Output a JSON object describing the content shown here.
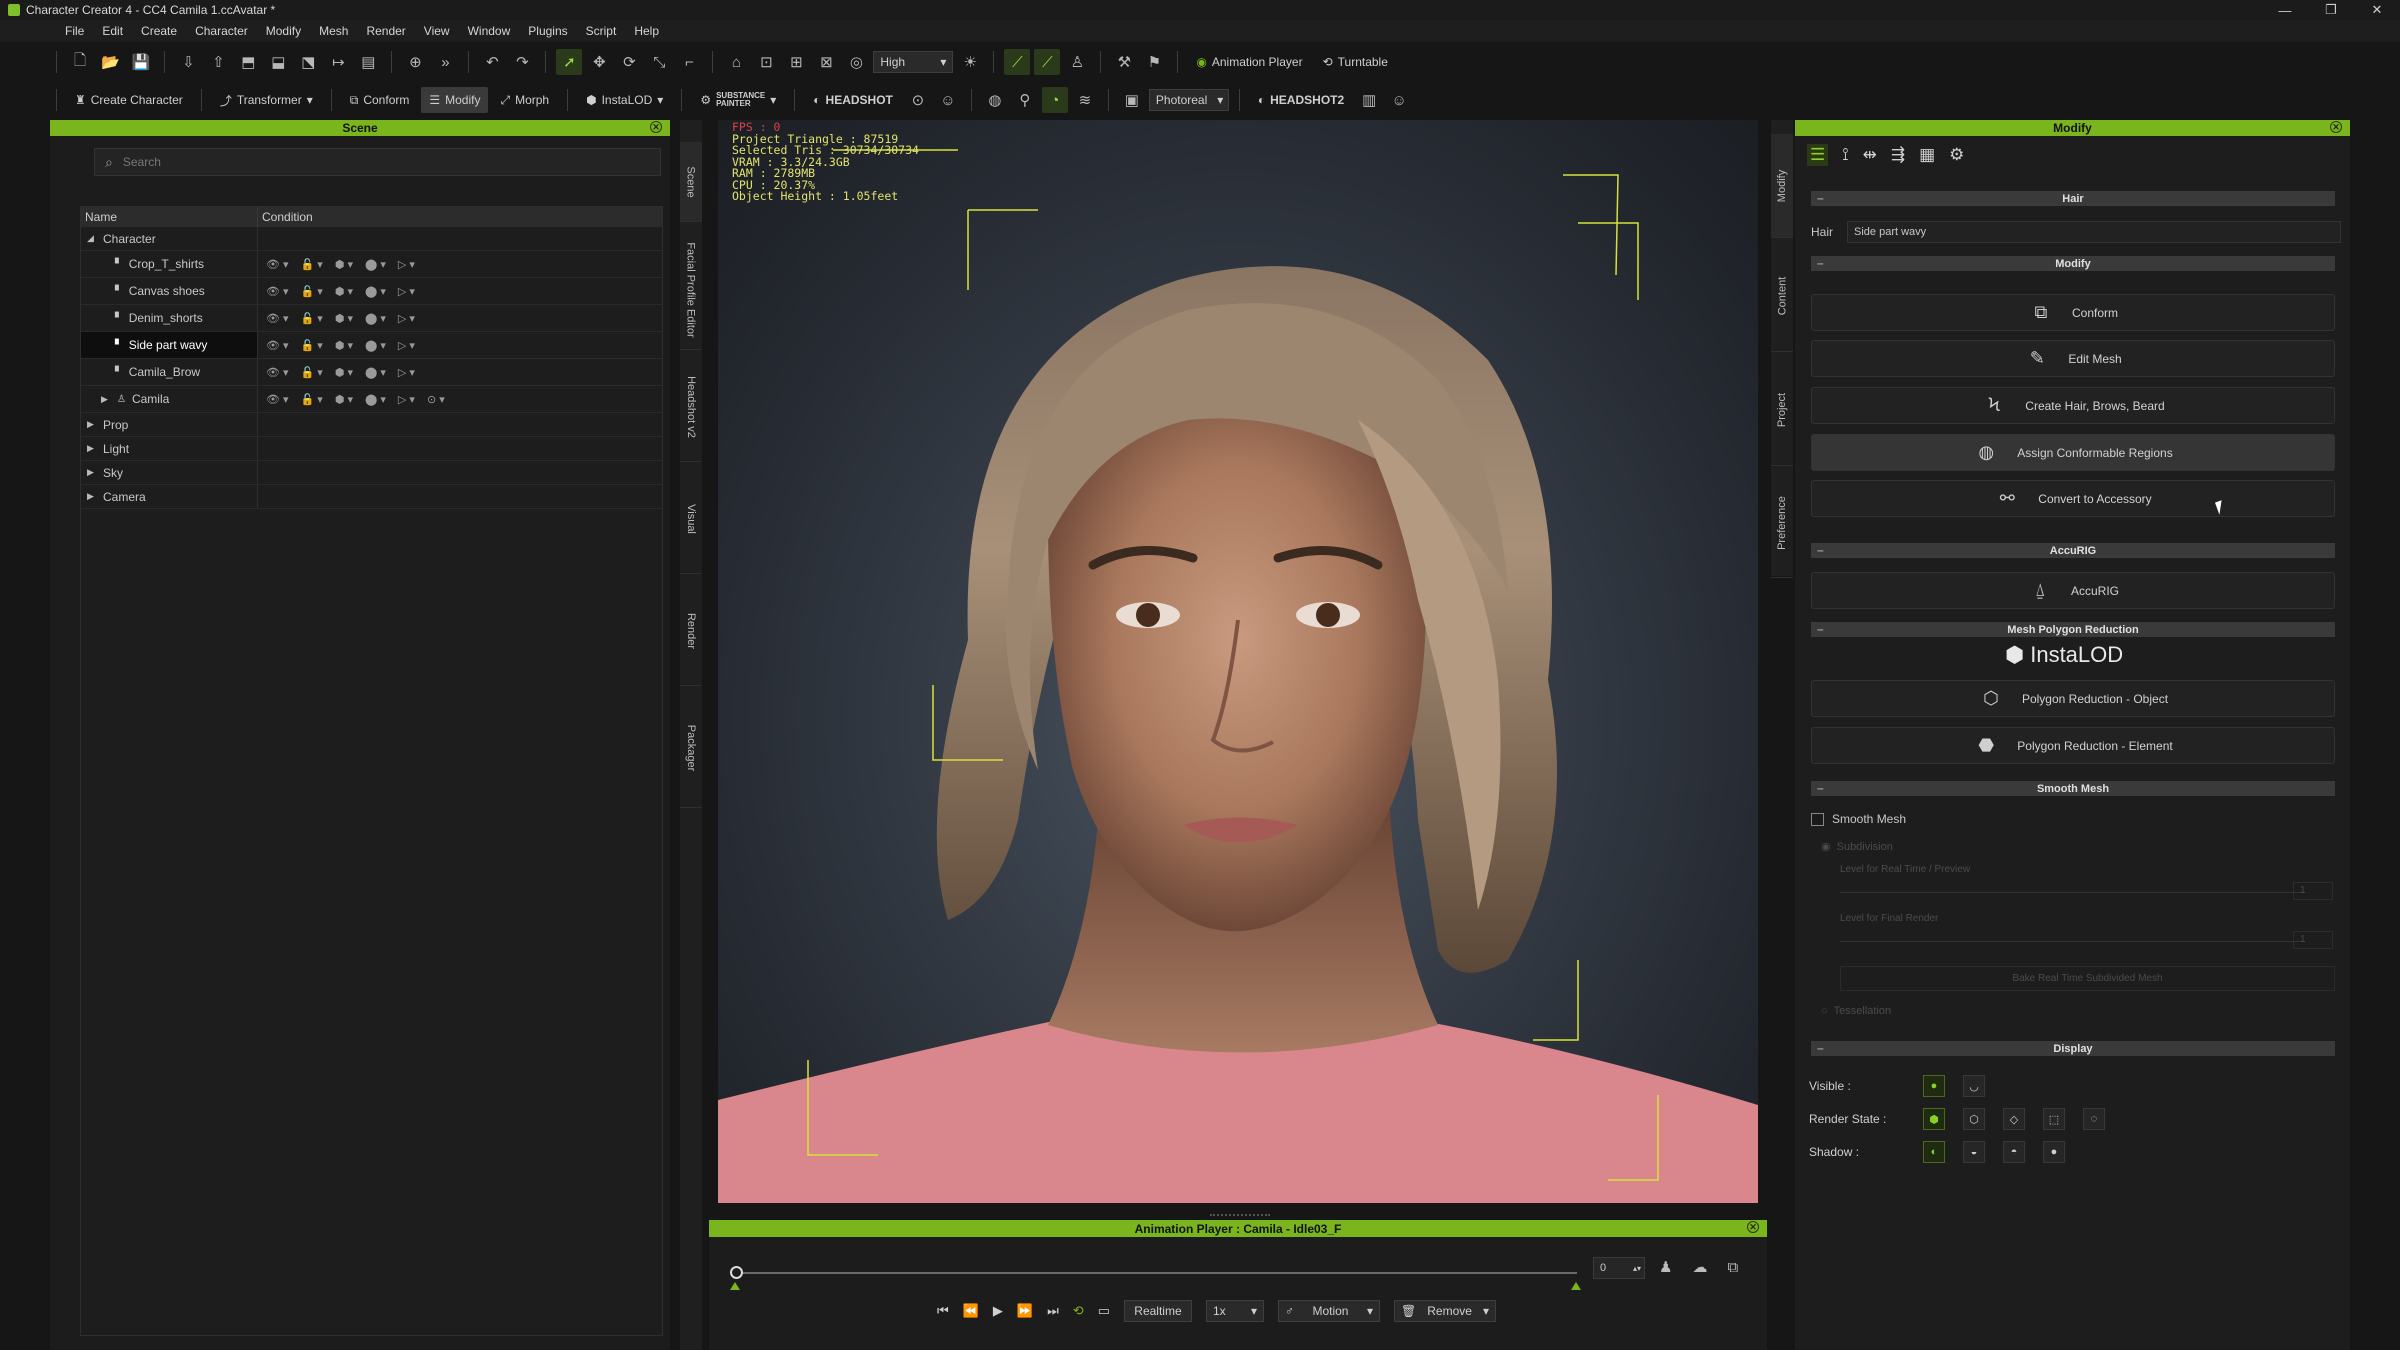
{
  "window": {
    "title": "Character Creator 4 - CC4 Camila 1.ccAvatar *",
    "controls": [
      "—",
      "❐",
      "✕"
    ]
  },
  "menu": [
    "File",
    "Edit",
    "Create",
    "Character",
    "Modify",
    "Mesh",
    "Render",
    "View",
    "Window",
    "Plugins",
    "Script",
    "Help"
  ],
  "toolbar1": {
    "quality_value": "High",
    "animation_player_label": "Animation Player",
    "turntable_label": "Turntable"
  },
  "toolbar2": {
    "create_character_label": "Create Character",
    "transformer_label": "Transformer",
    "conform_label": "Conform",
    "modify_label": "Modify",
    "morph_label": "Morph",
    "instalod_label": "InstaLOD",
    "substance_label": "SUBSTANCE",
    "substance_sub": "PAINTER",
    "headshot_label": "HEADSHOT",
    "render_mode_value": "Photoreal",
    "headshot2_label": "HEADSHOT2"
  },
  "scene": {
    "title": "Scene",
    "search_placeholder": "Search",
    "col_name": "Name",
    "col_condition": "Condition",
    "character_label": "Character",
    "items": [
      {
        "name": "Crop_T_shirts",
        "selected": false,
        "extra": false
      },
      {
        "name": "Canvas shoes",
        "selected": false,
        "extra": false
      },
      {
        "name": "Denim_shorts",
        "selected": false,
        "extra": false
      },
      {
        "name": "Side part wavy",
        "selected": true,
        "extra": false
      },
      {
        "name": "Camila_Brow",
        "selected": false,
        "extra": false
      },
      {
        "name": "Camila",
        "selected": false,
        "extra": true
      }
    ],
    "groups": [
      "Prop",
      "Light",
      "Sky",
      "Camera"
    ]
  },
  "left_vtabs": [
    "Scene",
    "Facial Profile Editor",
    "Headshot v2",
    "Visual",
    "Render",
    "Packager"
  ],
  "right_vtabs": [
    "Modify",
    "Content",
    "Project",
    "Preference"
  ],
  "viewport_stats": {
    "fps": "FPS : 0",
    "lines": [
      "Project Triangle : 87519",
      "Selected Tris : 30734/30734",
      "VRAM : 3.3/24.3GB",
      "RAM : 2789MB",
      "CPU : 20.37%",
      "Object Height : 1.05feet"
    ]
  },
  "anim_player": {
    "title": "Animation Player : Camila - Idle03_F",
    "frame_value": "0",
    "realtime_label": "Realtime",
    "speed_value": "1x",
    "motion_label": "Motion",
    "remove_label": "Remove"
  },
  "modify": {
    "title": "Modify",
    "hair_section": "Hair",
    "hair_label": "Hair",
    "hair_value": "Side part wavy",
    "modify_section": "Modify",
    "modify_buttons": [
      "Conform",
      "Edit Mesh",
      "Create Hair, Brows, Beard",
      "Assign Conformable Regions",
      "Convert to Accessory"
    ],
    "accurig_section": "AccuRIG",
    "accurig_button": "AccuRIG",
    "poly_section": "Mesh Polygon Reduction",
    "instalod_logo": "InstaLOD",
    "poly_buttons": [
      "Polygon Reduction - Object",
      "Polygon Reduction - Element"
    ],
    "smooth_section": "Smooth Mesh",
    "smooth_checkbox": "Smooth Mesh",
    "subdivision_label": "Subdivision",
    "level_realtime_label": "Level for Real Time / Preview",
    "level_realtime_value": "1",
    "level_final_label": "Level for Final Render",
    "level_final_value": "1",
    "bake_button": "Bake Real Time Subdivided Mesh",
    "tessellation_label": "Tessellation",
    "display_section": "Display",
    "visible_label": "Visible :",
    "render_state_label": "Render State :",
    "shadow_label": "Shadow :"
  },
  "colors": {
    "accent": "#7ab51d",
    "panel_bg": "#1d1d1d",
    "stats_text": "#e3e36a",
    "fps_text": "#e04040",
    "selection_frame": "#d6e23a",
    "shirt": "#d9868c"
  }
}
